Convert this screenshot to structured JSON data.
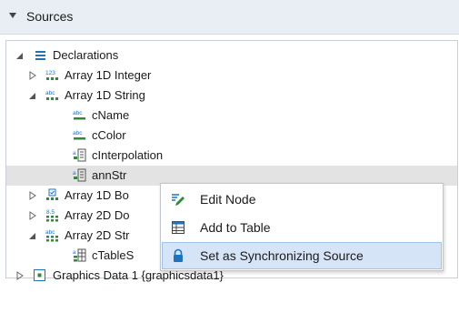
{
  "header": {
    "title": "Sources",
    "expand_icon": "triangle-down-icon"
  },
  "tree": {
    "nodes": [
      {
        "label": "Declarations",
        "icon": "declarations-icon",
        "expander": "expanded"
      },
      {
        "label": "Array 1D Integer",
        "icon": "array-1d-integer-icon",
        "expander": "collapsed"
      },
      {
        "label": "Array 1D String",
        "icon": "array-1d-string-icon",
        "expander": "expanded"
      },
      {
        "label": "cName",
        "icon": "string-icon"
      },
      {
        "label": "cColor",
        "icon": "string-icon"
      },
      {
        "label": "cInterpolation",
        "icon": "interpolation-icon"
      },
      {
        "label": "annStr",
        "icon": "interpolation-icon",
        "selected": true
      },
      {
        "label": "Array 1D Bo",
        "icon": "array-1d-boolean-icon",
        "expander": "collapsed"
      },
      {
        "label": "Array 2D Do",
        "icon": "array-2d-double-icon",
        "expander": "collapsed"
      },
      {
        "label": "Array 2D Str",
        "icon": "array-2d-string-icon",
        "expander": "expanded"
      },
      {
        "label": "cTableS",
        "icon": "table-icon"
      },
      {
        "label": "Graphics Data 1 {graphicsdata1}",
        "icon": "graphics-data-icon",
        "expander": "collapsed"
      }
    ]
  },
  "context_menu": {
    "items": [
      {
        "label": "Edit Node",
        "icon": "edit-node-icon"
      },
      {
        "label": "Add to Table",
        "icon": "add-to-table-icon"
      },
      {
        "label": "Set as Synchronizing Source",
        "icon": "lock-icon",
        "highlighted": true
      }
    ]
  },
  "colors": {
    "header_bg": "#e9eef4",
    "selection_bg": "#e3e3e3",
    "menu_highlight": "#d5e4f6",
    "accent_blue": "#1e73be",
    "accent_green": "#2e8b3a"
  }
}
